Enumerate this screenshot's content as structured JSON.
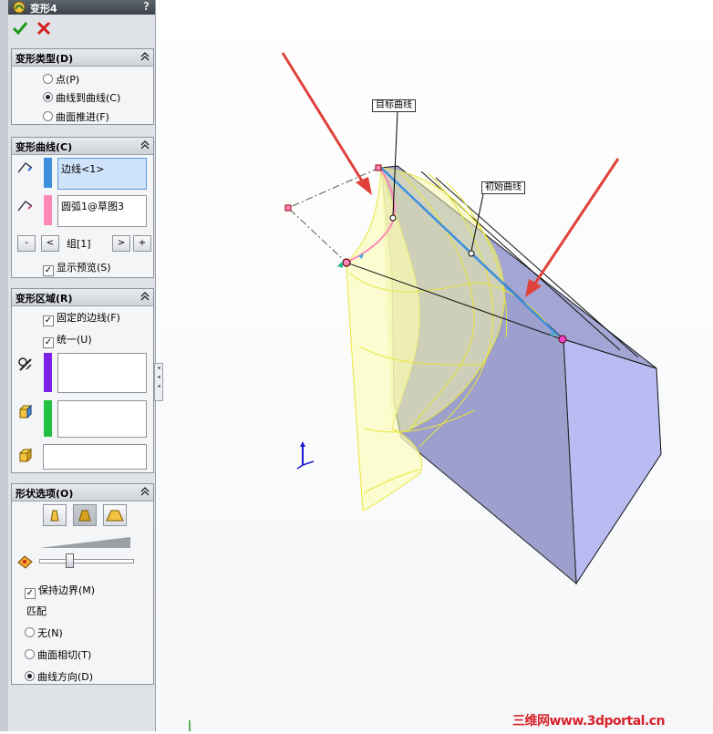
{
  "panel": {
    "title": "变形4",
    "help": "?",
    "groups": {
      "deform_type": {
        "title": "变形类型(D)",
        "options": [
          "点(P)",
          "曲线到曲线(C)",
          "曲面推进(F)"
        ],
        "selected": "曲线到曲线(C)"
      },
      "deform_curves": {
        "title": "变形曲线(C)",
        "initial_curve": "边线<1>",
        "target_curve": "圆弧1@草图3",
        "group_label": "组[1]",
        "btn_minus": "-",
        "btn_prev": "<",
        "btn_next": ">",
        "btn_plus": "+",
        "show_preview": "显示预览(S)",
        "initial_color": "#3d8fe0",
        "target_color": "#ff88b8"
      },
      "deform_region": {
        "title": "变形区域(R)",
        "fixed_edges": "固定的边线(F)",
        "uniform": "统一(U)",
        "color_1": "#7a22e8",
        "color_2": "#22c043"
      },
      "shape_options": {
        "title": "形状选项(O)",
        "keep_boundary": "保持边界(M)",
        "match_label": "匹配",
        "match_options": [
          "无(N)",
          "曲面相切(T)",
          "曲线方向(D)"
        ],
        "match_selected": "曲线方向(D)",
        "stiffness_fraction": 0.3
      }
    }
  },
  "viewport": {
    "callout_target": "目标曲线",
    "callout_initial": "初始曲线",
    "accent_arrow": "#e0413a",
    "body_fill": "#a6a9d6",
    "preview_fill": "#fafbb0"
  },
  "watermark": "三维网www.3dportal.cn"
}
